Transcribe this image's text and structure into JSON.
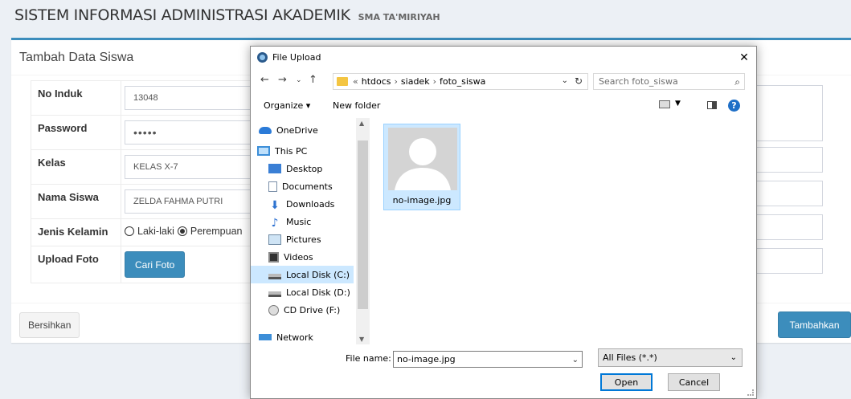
{
  "header": {
    "title": "SISTEM INFORMASI ADMINISTRASI AKADEMIK",
    "subtitle": "SMA TA'MIRIYAH"
  },
  "box": {
    "title": "Tambah Data Siswa"
  },
  "form": {
    "no_induk_label": "No Induk",
    "no_induk_value": "13048",
    "password_label": "Password",
    "password_value": "•••••",
    "kelas_label": "Kelas",
    "kelas_value": "KELAS X-7",
    "nama_label": "Nama Siswa",
    "nama_value": "ZELDA FAHMA PUTRI",
    "jk_label": "Jenis Kelamin",
    "jk_option_male": "Laki-laki",
    "jk_option_female": "Perempuan",
    "jk_selected": "Perempuan",
    "foto_label": "Upload Foto",
    "foto_button": "Cari Foto"
  },
  "footer": {
    "reset_label": "Bersihkan",
    "submit_label": "Tambahkan"
  },
  "dialog": {
    "title": "File Upload",
    "close_glyph": "✕",
    "path": [
      "«",
      "htdocs",
      "›",
      "siadek",
      "›",
      "foto_siswa"
    ],
    "search_placeholder": "Search foto_siswa",
    "organize_label": "Organize ▾",
    "new_folder_label": "New folder",
    "help_glyph": "?",
    "nav_items": [
      "OneDrive",
      "This PC",
      "Desktop",
      "Documents",
      "Downloads",
      "Music",
      "Pictures",
      "Videos",
      "Local Disk (C:)",
      "Local Disk (D:)",
      "CD Drive (F:)",
      "Network"
    ],
    "selected_nav": "Local Disk (C:)",
    "file": {
      "name": "no-image.jpg"
    },
    "filename_label": "File name:",
    "filename_value": "no-image.jpg",
    "filetype_value": "All Files (*.*)",
    "open_label": "Open",
    "cancel_label": "Cancel"
  },
  "colors": {
    "primary": "#3c8dbc",
    "selection": "#cce8ff",
    "background": "#ecf0f5"
  }
}
